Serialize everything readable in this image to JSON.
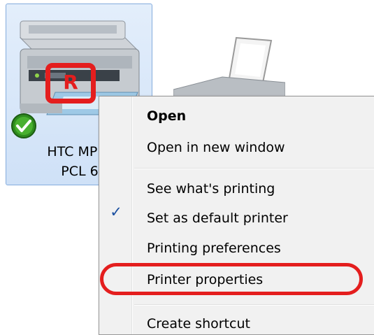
{
  "printer_tile": {
    "label_line1": "HTC MP C",
    "label_line2": "PCL 6",
    "badge_letter": "R"
  },
  "context_menu": {
    "items": [
      {
        "label": "Open",
        "bold": true
      },
      {
        "label": "Open in new window"
      },
      {
        "label": "See what's printing"
      },
      {
        "label": "Set as default printer",
        "checked": true
      },
      {
        "label": "Printing preferences"
      },
      {
        "label": "Printer properties",
        "highlighted": true
      },
      {
        "label": "Create shortcut"
      }
    ],
    "check_glyph": "✓"
  },
  "colors": {
    "annotation_red": "#e41e1e",
    "selection_blue": "#cfe1f7",
    "menu_bg": "#f1f1f1"
  }
}
